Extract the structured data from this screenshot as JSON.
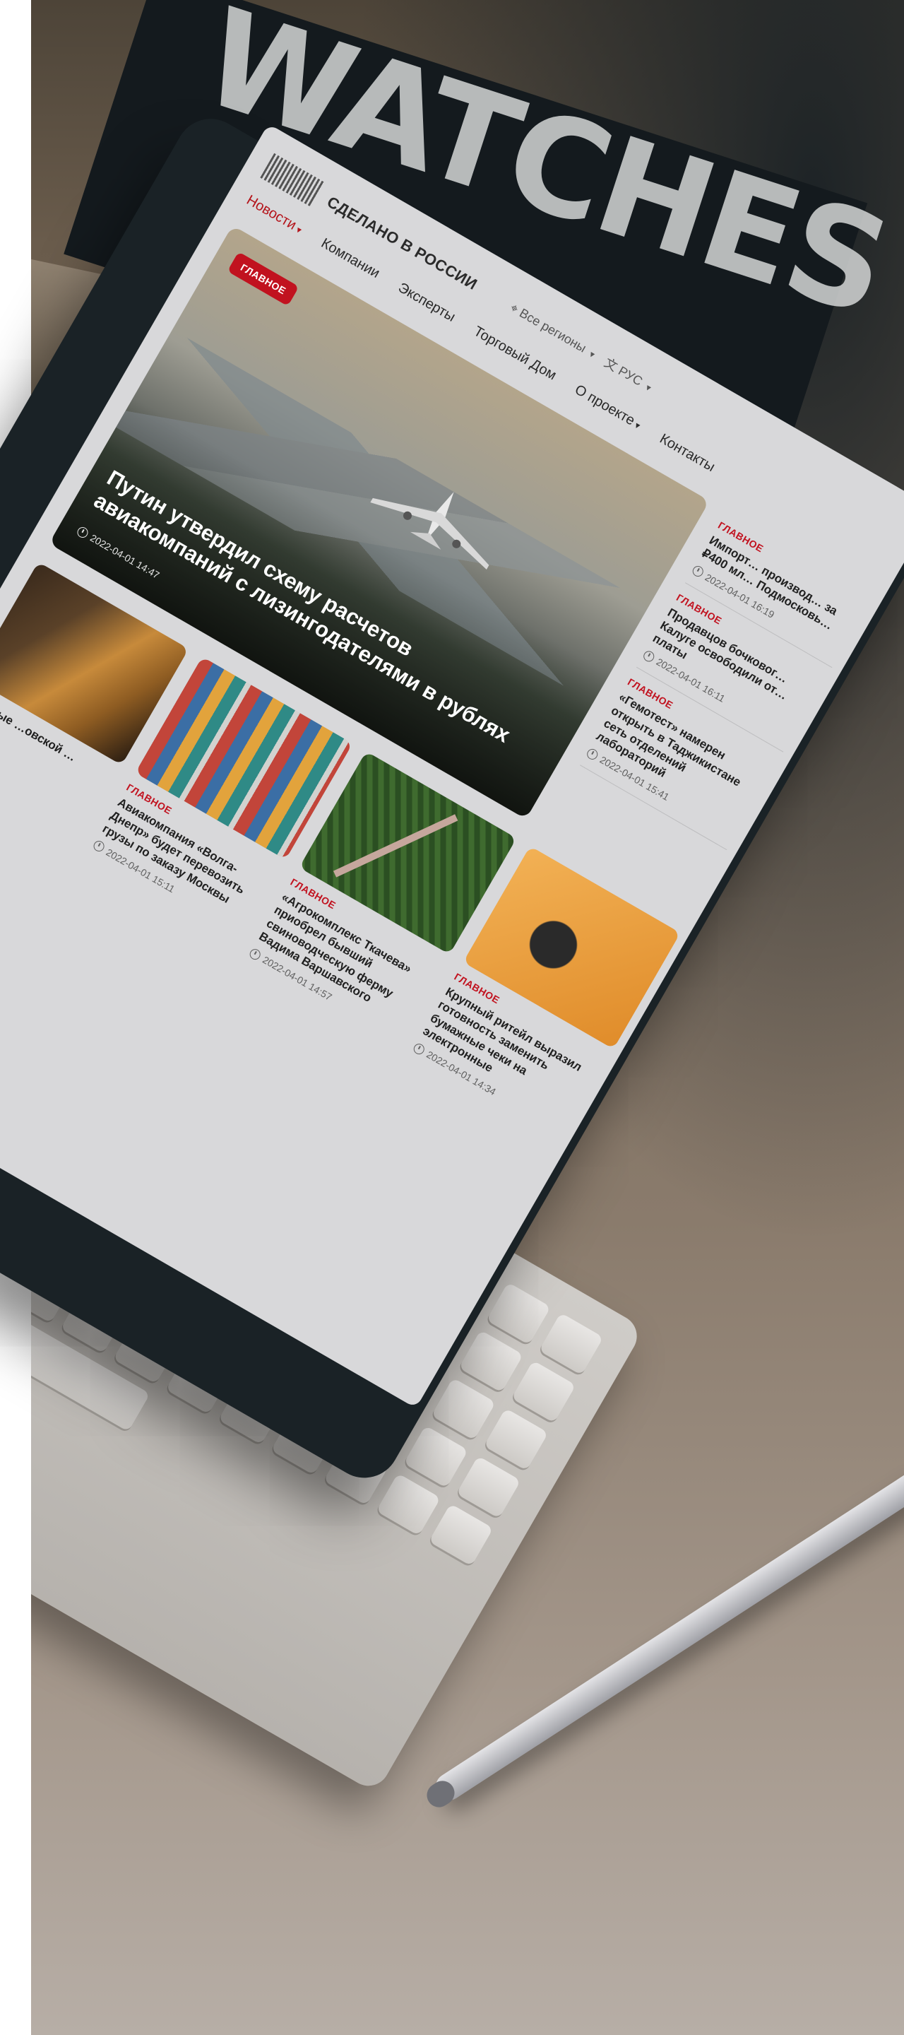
{
  "backdrop": {
    "book_title": "WATCHES"
  },
  "site": {
    "brand": "СДЕЛАНО В РОССИИ",
    "region": "Все регионы",
    "language": "РУС",
    "nav": [
      {
        "label": "Новости",
        "active": true,
        "dropdown": true
      },
      {
        "label": "Компании"
      },
      {
        "label": "Эксперты"
      },
      {
        "label": "Торговый Дом"
      },
      {
        "label": "О проекте",
        "dropdown": true
      },
      {
        "label": "Контакты"
      }
    ],
    "hero": {
      "badge": "ГЛАВНОЕ",
      "title": "Путин утвердил схему расчетов авиакомпаний с лизингодателями в рублях",
      "date": "2022-04-01 14:47"
    },
    "side_news": [
      {
        "tag": "ГЛАВНОЕ",
        "title": "Импорт… производ… за ₽400 мл… Подмосковь…",
        "date": "2022-04-01 16:19"
      },
      {
        "tag": "ГЛАВНОЕ",
        "title": "Продавцов бочковог… Калуге освободили от… платы",
        "date": "2022-04-01 16:11"
      },
      {
        "tag": "ГЛАВНОЕ",
        "title": "«Гемотест» намерен открыть в Таджикистане сеть отделений лабораторий",
        "date": "2022-04-01 15:41"
      }
    ],
    "cards": [
      {
        "tag": "",
        "title": "…первые …овской …",
        "date": ""
      },
      {
        "tag": "ГЛАВНОЕ",
        "title": "Авиакомпания «Волга-Днепр» будет перевозить грузы по заказу Москвы",
        "date": "2022-04-01 15:11"
      },
      {
        "tag": "ГЛАВНОЕ",
        "title": "«Агрокомплекс Ткачева» приобрел бывший свиноводческую ферму Вадима Варшавского",
        "date": "2022-04-01 14:57"
      },
      {
        "tag": "ГЛАВНОЕ",
        "title": "Крупный ритейл выразил готовность заменить бумажные чеки на электронные",
        "date": "2022-04-01 14:34"
      }
    ]
  },
  "colors": {
    "accent": "#c1121f",
    "bezel": "#1a2226",
    "screen_bg": "#d8d8da"
  }
}
